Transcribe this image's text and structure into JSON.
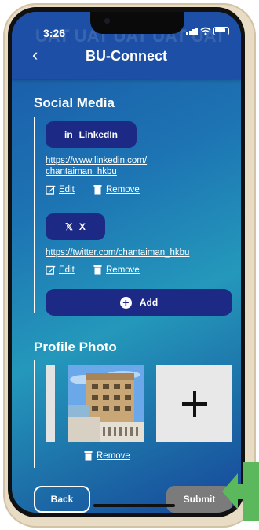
{
  "status_bar": {
    "time": "3:26"
  },
  "watermark": "UAT UAT UAT UAT UAT",
  "header": {
    "title": "BU-Connect"
  },
  "social_media": {
    "title": "Social Media",
    "entries": [
      {
        "platform_label": "LinkedIn",
        "icon_text": "in",
        "url_line1": "https://www.linkedin.com/",
        "url_line2": "chantaiman_hkbu",
        "edit_label": "Edit",
        "remove_label": "Remove"
      },
      {
        "platform_label": "X",
        "icon_text": "𝕏",
        "url_line1": "https://twitter.com/chantaiman_hkbu",
        "url_line2": "",
        "edit_label": "Edit",
        "remove_label": "Remove"
      }
    ],
    "add_label": "Add"
  },
  "profile_photo": {
    "title": "Profile Photo",
    "remove_label": "Remove"
  },
  "footer": {
    "back_label": "Back",
    "submit_label": "Submit"
  },
  "colors": {
    "header": "#1c4fa5",
    "pill": "#1c2a85",
    "submit_disabled": "#7b7b7b",
    "pointer_arrow": "#5cb85c"
  }
}
